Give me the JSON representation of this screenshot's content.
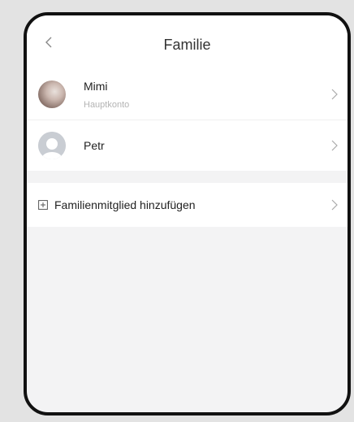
{
  "header": {
    "back_icon": "chevron-left-icon",
    "title": "Familie"
  },
  "members": [
    {
      "name": "Mimi",
      "role": "Hauptkonto",
      "avatar": "photo"
    },
    {
      "name": "Petr",
      "avatar": "default"
    }
  ],
  "add_member": {
    "icon": "plus-box-icon",
    "label": "Familienmitglied hinzufügen"
  },
  "colors": {
    "background": "#f3f3f4",
    "card": "#ffffff",
    "text": "#222222",
    "subtext": "#b3b3b3",
    "frame": "#111111"
  }
}
